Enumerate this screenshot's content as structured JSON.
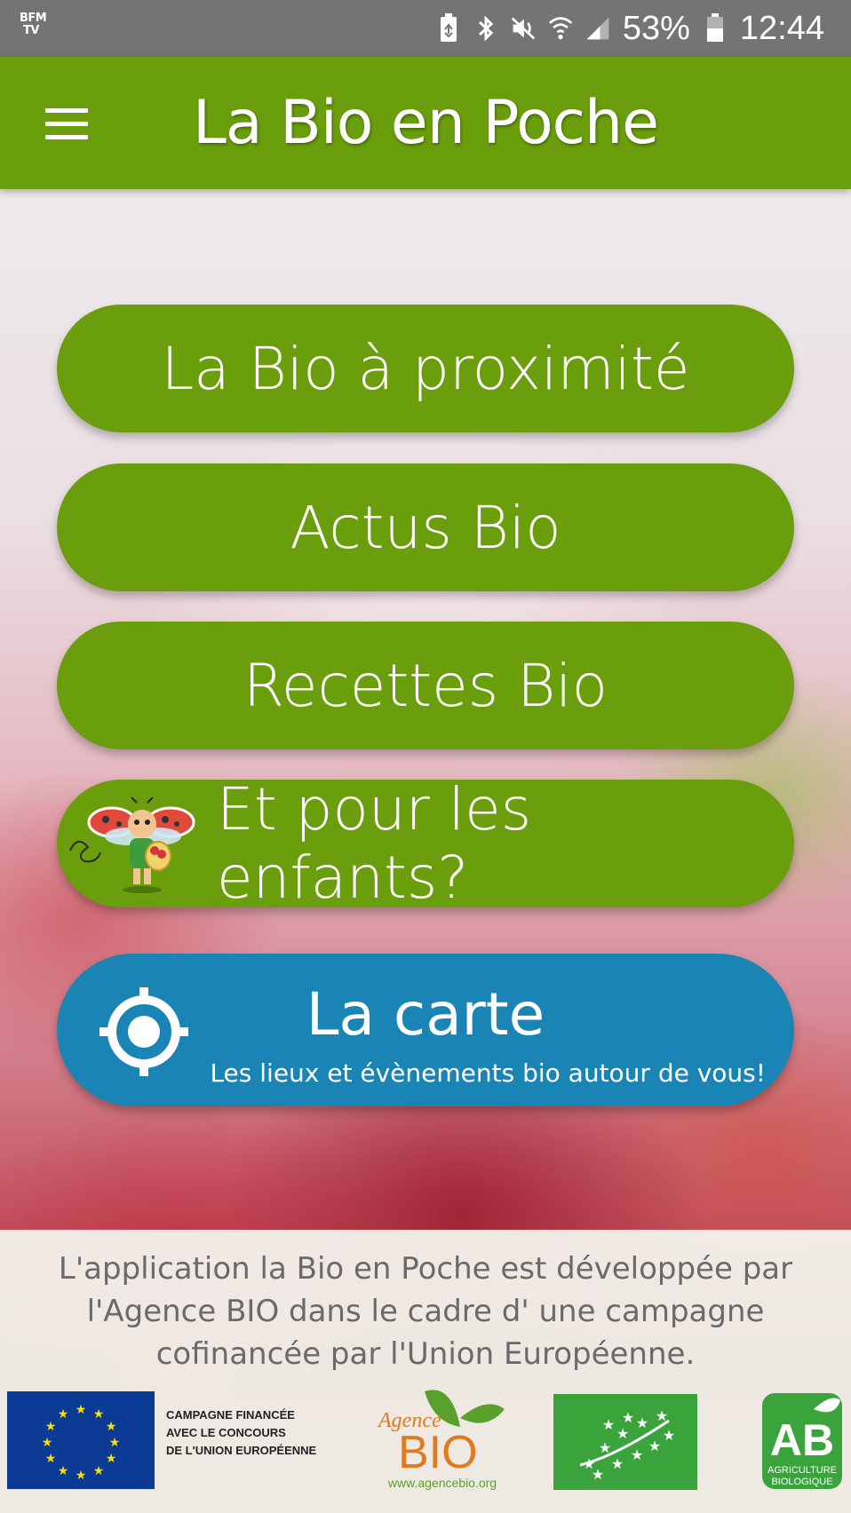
{
  "status_bar": {
    "left_badge": "BFM TV",
    "battery_percent": "53%",
    "time": "12:44",
    "icons": [
      "battery-saver-icon",
      "bluetooth-icon",
      "mute-icon",
      "wifi-icon",
      "signal-icon",
      "battery-icon"
    ]
  },
  "app_bar": {
    "title": "La Bio en Poche",
    "menu_icon": "hamburger-menu-icon"
  },
  "buttons": {
    "proximity": "La Bio à proximité",
    "news": "Actus Bio",
    "recipes": "Recettes Bio",
    "kids": "Et pour les enfants?"
  },
  "map_button": {
    "title": "La carte",
    "subtitle": "Les lieux et évènements bio autour de vous!",
    "icon": "location-target-icon"
  },
  "footer": {
    "text": "L'application la Bio en Poche est développée par l'Agence BIO dans le cadre d' une campagne cofinancée par l'Union Européenne.",
    "eu_caption_line1": "CAMPAGNE FINANCÉE",
    "eu_caption_line2": "AVEC LE CONCOURS",
    "eu_caption_line3": "DE L'UNION EUROPÉENNE",
    "agence_word": "Agence",
    "agence_bio": "BIO",
    "agence_url": "www.agencebio.org",
    "ab_letters": "AB",
    "ab_line1": "AGRICULTURE",
    "ab_line2": "BIOLOGIQUE"
  },
  "colors": {
    "green": "#6a9e0c",
    "blue": "#1a84b5",
    "status_bar": "#747474"
  }
}
